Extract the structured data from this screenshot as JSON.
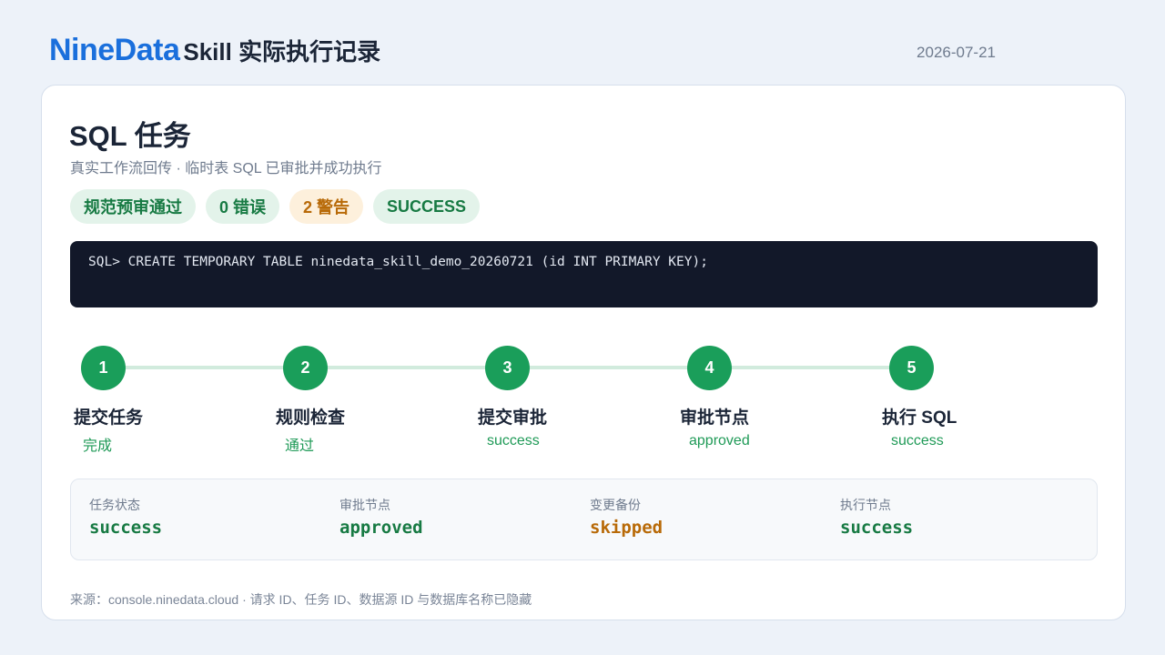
{
  "header": {
    "brand": "NineData",
    "title": "Skill 实际执行记录",
    "date": "2026-07-21"
  },
  "task": {
    "title": "SQL 任务",
    "subtitle": "真实工作流回传 · 临时表 SQL 已审批并成功执行"
  },
  "badges": [
    {
      "label": "规范预审通过",
      "tone": "green"
    },
    {
      "label": "0 错误",
      "tone": "green"
    },
    {
      "label": "2 警告",
      "tone": "orange"
    },
    {
      "label": "SUCCESS",
      "tone": "green"
    }
  ],
  "terminal": {
    "prompt": "SQL>",
    "command": "CREATE TEMPORARY TABLE ninedata_skill_demo_20260721 (id INT PRIMARY KEY);"
  },
  "steps": [
    {
      "number": "1",
      "label": "提交任务",
      "status": "完成"
    },
    {
      "number": "2",
      "label": "规则检查",
      "status": "通过"
    },
    {
      "number": "3",
      "label": "提交审批",
      "status": "success"
    },
    {
      "number": "4",
      "label": "审批节点",
      "status": "approved"
    },
    {
      "number": "5",
      "label": "执行 SQL",
      "status": "success"
    }
  ],
  "summary": [
    {
      "label": "任务状态",
      "value": "success",
      "tone": "green"
    },
    {
      "label": "审批节点",
      "value": "approved",
      "tone": "green"
    },
    {
      "label": "变更备份",
      "value": "skipped",
      "tone": "orange"
    },
    {
      "label": "执行节点",
      "value": "success",
      "tone": "green"
    }
  ],
  "footer": "来源：console.ninedata.cloud · 请求 ID、任务 ID、数据源 ID 与数据库名称已隐藏",
  "colors": {
    "brand": "#1a6fdc",
    "success": "#1a9e5a",
    "warning": "#b86a08",
    "terminal_bg": "#121829"
  }
}
